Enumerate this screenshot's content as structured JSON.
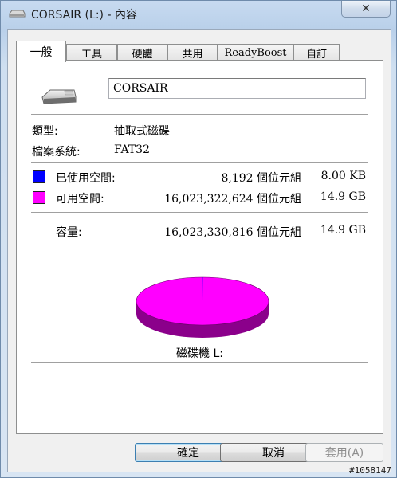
{
  "window": {
    "title": "CORSAIR (L:) - 內容",
    "close_glyph": "✕"
  },
  "tabs": [
    {
      "label": "一般",
      "active": true
    },
    {
      "label": "工具",
      "active": false
    },
    {
      "label": "硬體",
      "active": false
    },
    {
      "label": "共用",
      "active": false
    },
    {
      "label": "ReadyBoost",
      "active": false
    },
    {
      "label": "自訂",
      "active": false
    }
  ],
  "general": {
    "volume_name": "CORSAIR",
    "type_label": "類型:",
    "type_value": "抽取式磁碟",
    "fs_label": "檔案系統:",
    "fs_value": "FAT32",
    "used": {
      "label": "已使用空間:",
      "bytes": "8,192 個位元組",
      "size": "8.00 KB",
      "color": "#0000ff"
    },
    "free": {
      "label": "可用空間:",
      "bytes": "16,023,322,624 個位元組",
      "size": "14.9 GB",
      "color": "#ff00ff"
    },
    "capacity": {
      "label": "容量:",
      "bytes": "16,023,330,816 個位元組",
      "size": "14.9 GB"
    },
    "pie": {
      "used_fraction": 5e-07,
      "free_color": "#ff00ff",
      "free_shadow": "#8b008b"
    },
    "drive_caption": "磁碟機 L:"
  },
  "buttons": {
    "ok": "確定",
    "cancel": "取消",
    "apply": "套用(A)"
  },
  "watermark": "#1058147"
}
